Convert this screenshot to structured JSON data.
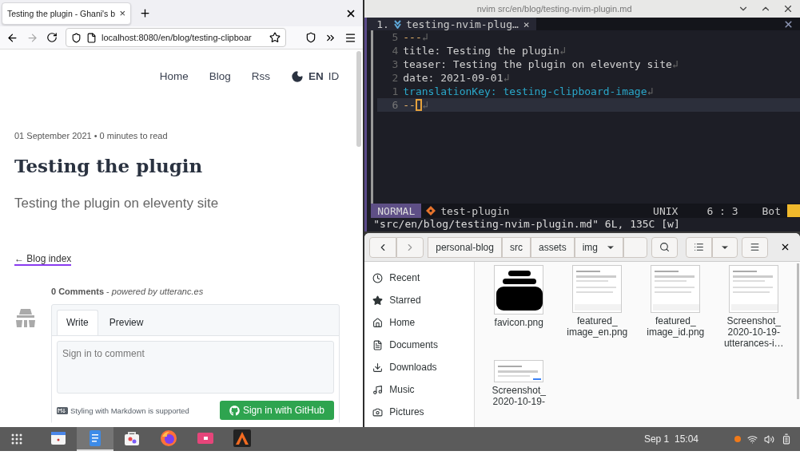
{
  "browser": {
    "tab": {
      "title": "Testing the plugin - Ghani's b",
      "close": "×"
    },
    "url": "localhost:8080/en/blog/testing-clipboar",
    "nav": [
      {
        "label": "Home"
      },
      {
        "label": "Blog"
      },
      {
        "label": "Rss"
      }
    ],
    "languages": [
      {
        "label": "EN",
        "selected": true
      },
      {
        "label": "ID",
        "selected": false
      }
    ],
    "meta": "01 September 2021 • 0 minutes to read",
    "title": "Testing the plugin",
    "teaser": "Testing the plugin on eleventy site",
    "back_link": "← Blog index",
    "comments": {
      "header": "**0 Comments** - *powered by utteranc.es*",
      "tabs": [
        {
          "label": "Write",
          "selected": true
        },
        {
          "label": "Preview",
          "selected": false
        }
      ],
      "placeholder": "Sign in to comment",
      "note": "Styling with Markdown is supported",
      "button": "Sign in with GitHub"
    }
  },
  "terminal": {
    "title": "nvim src/en/blog/testing-nvim-plugin.md",
    "buffer_number": "1.",
    "buffer_name": "testing-nvim-plug…",
    "buffer_close": "×",
    "lines": [
      {
        "number": "5",
        "text": "---",
        "eol": "↲",
        "kind": "delimiter",
        "current": false
      },
      {
        "number": "4",
        "text": "title: Testing the plugin",
        "eol": "↲",
        "kind": "plain",
        "current": false
      },
      {
        "number": "3",
        "text": "teaser: Testing the plugin on eleventy site",
        "eol": "↲",
        "kind": "plain",
        "current": false
      },
      {
        "number": "2",
        "text": "date: 2021-09-01",
        "eol": "↲",
        "kind": "plain",
        "current": false
      },
      {
        "number": "1",
        "text": "translationKey: testing-clipboard-image",
        "eol": "↲",
        "kind": "highlight",
        "current": false
      },
      {
        "number": "6",
        "text": "--",
        "eol": "↲",
        "kind": "delimiter",
        "current": true
      }
    ],
    "status": {
      "mode": "NORMAL",
      "branch": "test-plugin",
      "format": "UNIX",
      "position": "6 : 3",
      "scroll": "Bot"
    },
    "message": "\"src/en/blog/testing-nvim-plugin.md\" 6L, 135C [w]"
  },
  "files": {
    "path": [
      {
        "label": "personal-blog",
        "dropdown": false
      },
      {
        "label": "src",
        "dropdown": false
      },
      {
        "label": "assets",
        "dropdown": false
      },
      {
        "label": "img",
        "dropdown": true
      }
    ],
    "sidebar": [
      {
        "label": "Recent",
        "kind": "recent"
      },
      {
        "label": "Starred",
        "kind": "starred"
      },
      {
        "label": "Home",
        "kind": "home"
      },
      {
        "label": "Documents",
        "kind": "documents"
      },
      {
        "label": "Downloads",
        "kind": "downloads"
      },
      {
        "label": "Music",
        "kind": "music"
      },
      {
        "label": "Pictures",
        "kind": "pictures"
      }
    ],
    "items": [
      {
        "name_lines": [
          "favicon.png"
        ],
        "kind": "favicon"
      },
      {
        "name_lines": [
          "featured_",
          "image_en.png"
        ],
        "kind": "picture"
      },
      {
        "name_lines": [
          "featured_",
          "image_id.png"
        ],
        "kind": "picture"
      },
      {
        "name_lines": [
          "Screenshot_",
          "2020-10-19-",
          "utterances-i…"
        ],
        "kind": "picture"
      },
      {
        "name_lines": [
          "Screenshot_",
          "2020-10-19-"
        ],
        "kind": "picture"
      }
    ]
  },
  "taskbar": {
    "apps": [
      {
        "kind": "calendar",
        "selected": false
      },
      {
        "kind": "editor",
        "selected": true
      },
      {
        "kind": "store",
        "selected": false
      },
      {
        "kind": "firefox",
        "selected": false
      },
      {
        "kind": "media",
        "selected": false
      },
      {
        "kind": "terminal",
        "selected": false
      }
    ],
    "clock": "Sep 1  15:04"
  }
}
